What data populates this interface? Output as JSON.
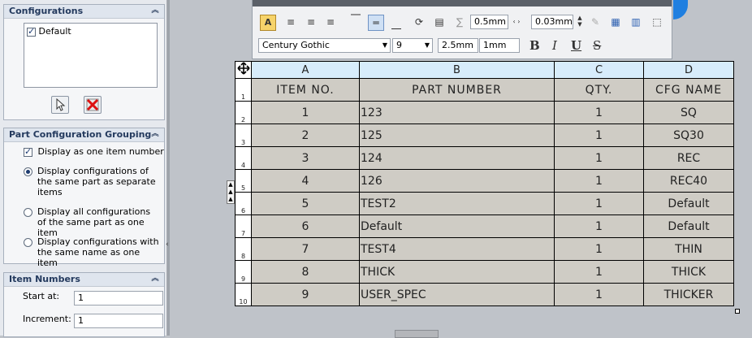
{
  "left_panel": {
    "configurations": {
      "title": "Configurations",
      "items": [
        "Default"
      ]
    },
    "grouping": {
      "title": "Part Configuration Grouping",
      "checkbox_label": "Display as one item number",
      "options": [
        "Display configurations of the same part as separate items",
        "Display all configurations of the same part as one item",
        "Display configurations with the same name as one item"
      ]
    },
    "item_numbers": {
      "title": "Item Numbers",
      "start_label": "Start at:",
      "start_value": "1",
      "increment_label": "Increment:",
      "increment_value": "1"
    }
  },
  "toolbar": {
    "border_width_1": "0.5mm",
    "border_width_2": "0.03mm",
    "font_name": "Century Gothic",
    "font_size": "9",
    "height_value": "2.5mm",
    "spacing_value": "1mm",
    "bold": "B",
    "italic": "I",
    "underline": "U",
    "strike": "S"
  },
  "bom": {
    "columns": [
      "A",
      "B",
      "C",
      "D"
    ],
    "row_numbers": [
      "1",
      "2",
      "3",
      "4",
      "5",
      "6",
      "7",
      "8",
      "9",
      "10"
    ],
    "header": [
      "ITEM NO.",
      "PART NUMBER",
      "QTY.",
      "CFG NAME"
    ],
    "rows": [
      [
        "1",
        "123",
        "1",
        "SQ"
      ],
      [
        "2",
        "125",
        "1",
        "SQ30"
      ],
      [
        "3",
        "124",
        "1",
        "REC"
      ],
      [
        "4",
        "126",
        "1",
        "REC40"
      ],
      [
        "5",
        "TEST2",
        "1",
        "Default"
      ],
      [
        "6",
        "Default",
        "1",
        "Default"
      ],
      [
        "7",
        "TEST4",
        "1",
        "THIN"
      ],
      [
        "8",
        "THICK",
        "1",
        "THICK"
      ],
      [
        "9",
        "USER_SPEC",
        "1",
        "THICKER"
      ]
    ]
  }
}
